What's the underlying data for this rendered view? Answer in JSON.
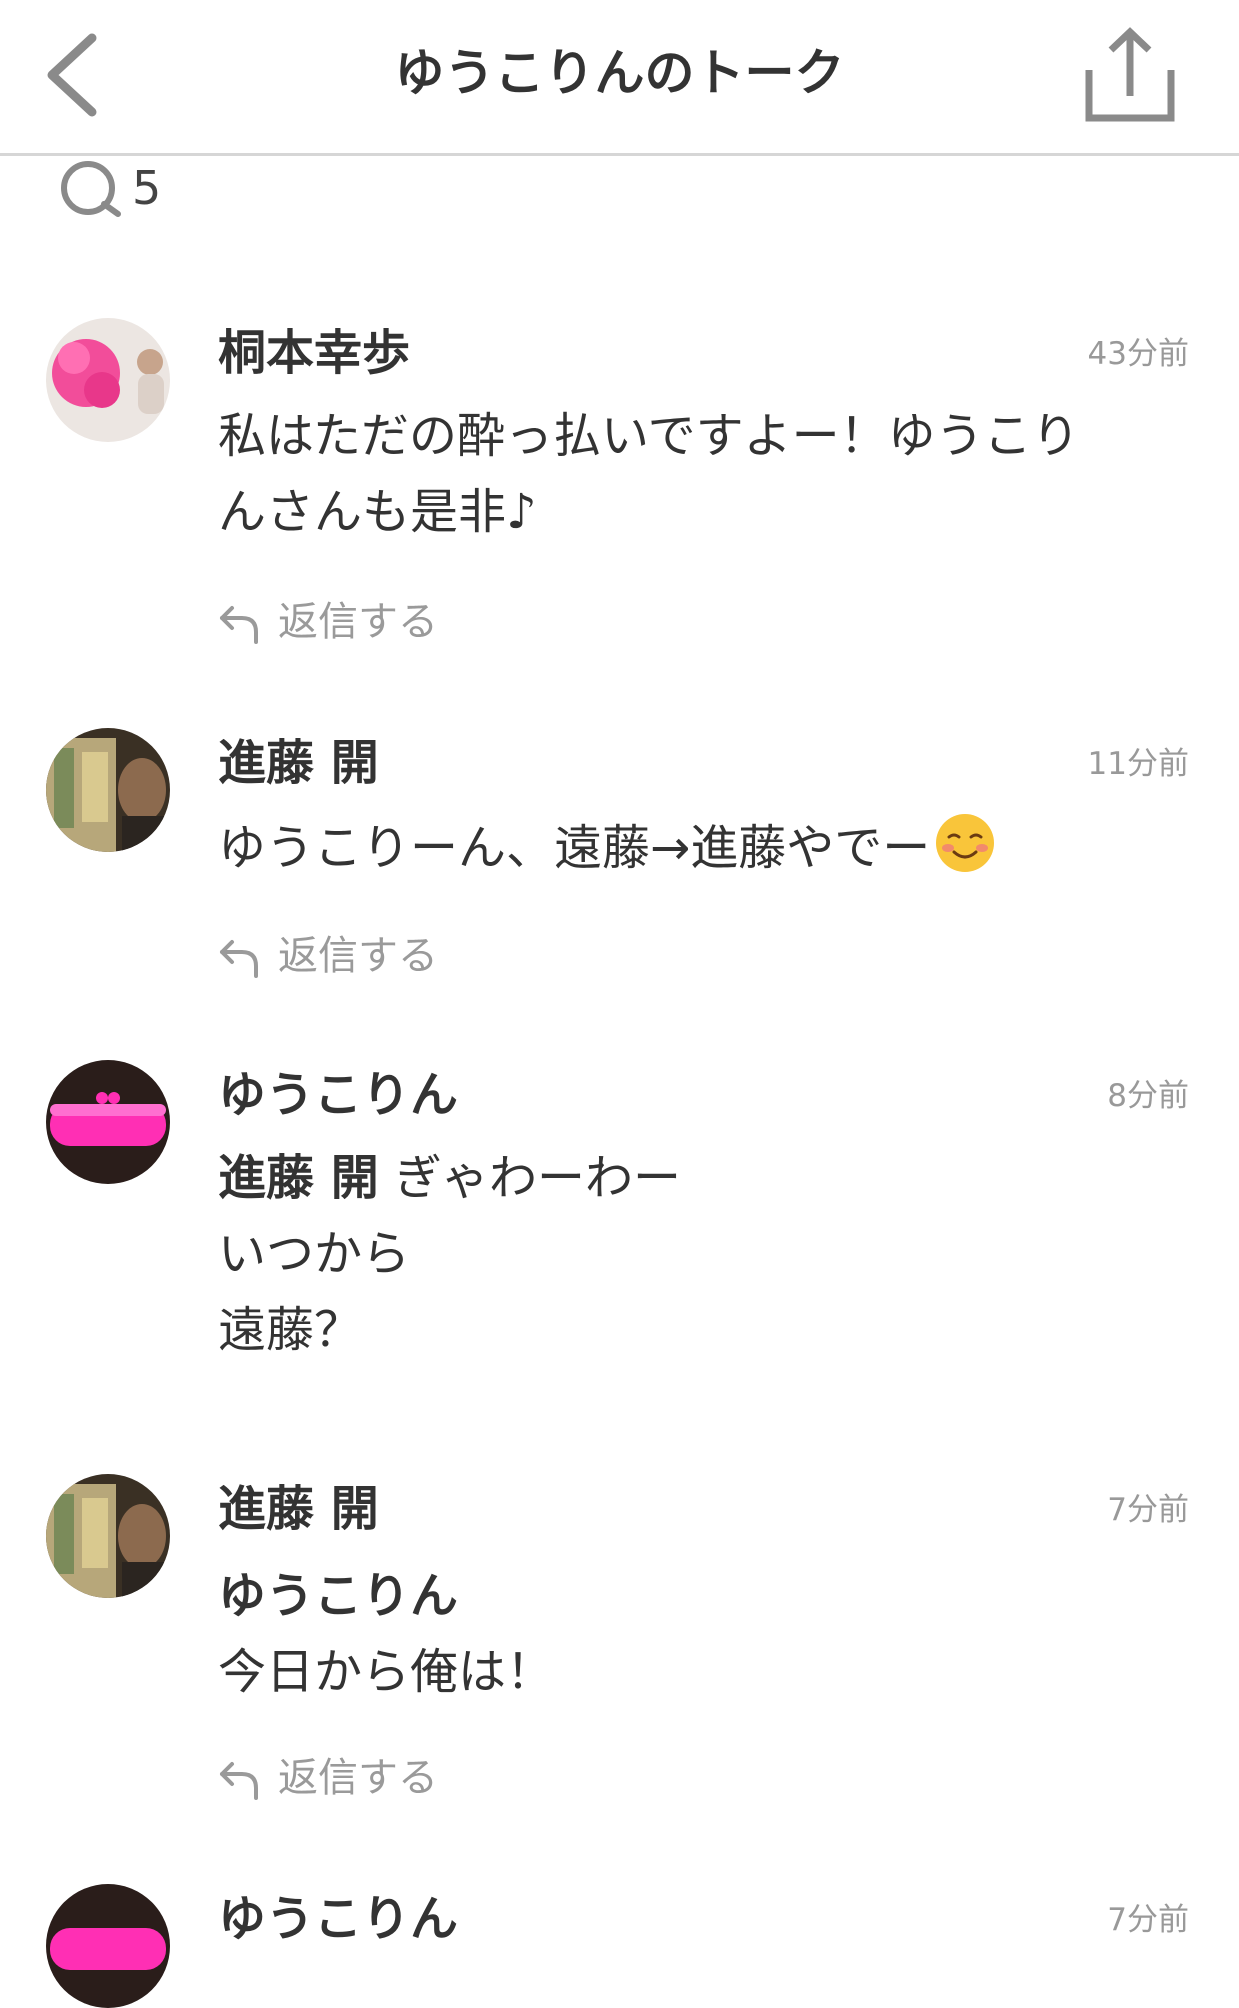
{
  "header": {
    "title": "ゆうこりんのトーク",
    "back_icon": "chevron-left-icon",
    "share_icon": "share-icon"
  },
  "comment_count": {
    "icon": "comment-bubble-icon",
    "value": "5"
  },
  "reply_label": "返信する",
  "comments": [
    {
      "name": "桐本幸歩",
      "time": "43分前",
      "lines": [
        "私はただの酔っ払いですよー！ゆうこり",
        "んさんも是非♪"
      ]
    },
    {
      "name": "進藤 開",
      "time": "11分前",
      "text": "ゆうこりーん、遠藤→進藤やでー",
      "emoji": "smiling-face-icon"
    },
    {
      "name": "ゆうこりん",
      "time": "8分前",
      "mention": "進藤 開",
      "mention_rest": " ぎゃわーわー",
      "lines": [
        "いつから",
        "遠藤？"
      ]
    },
    {
      "name": "進藤 開",
      "time": "7分前",
      "mention": "ゆうこりん",
      "lines": [
        "今日から俺は！"
      ]
    },
    {
      "name": "ゆうこりん",
      "time": "7分前"
    }
  ],
  "colors": {
    "accent_pink": "#ff2fb4",
    "meta_gray": "#999999"
  }
}
